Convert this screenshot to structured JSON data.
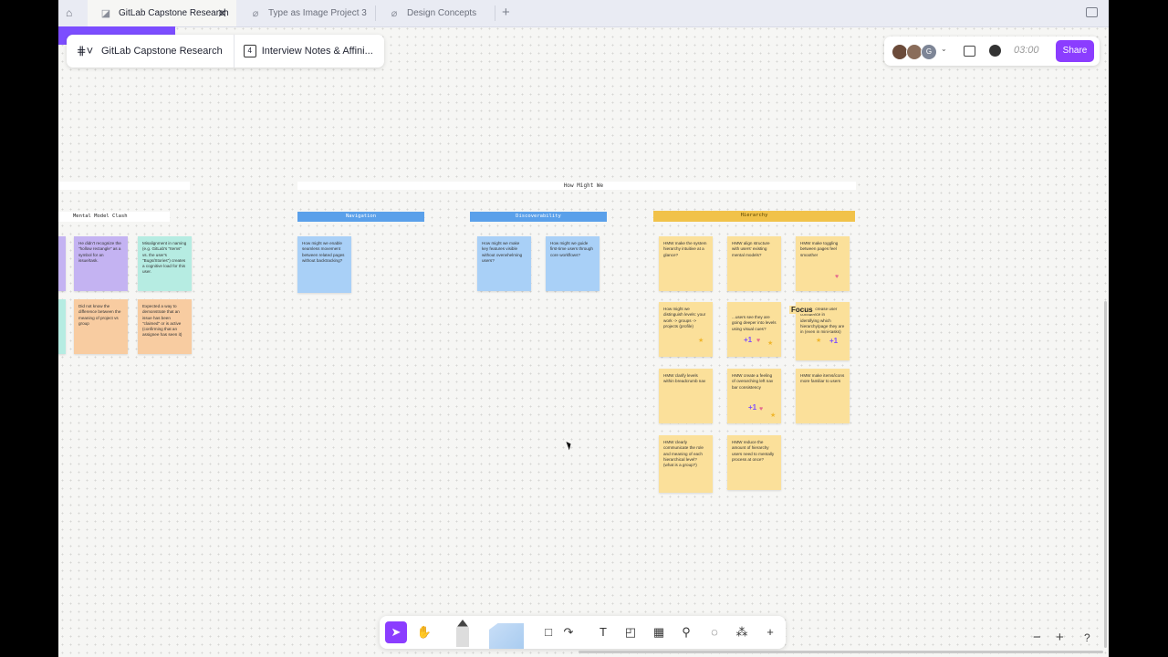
{
  "tabs": [
    {
      "label": "GitLab Capstone Research",
      "active": true
    },
    {
      "label": "Type as Image Project 3",
      "active": false
    },
    {
      "label": "Design Concepts",
      "active": false
    }
  ],
  "file": {
    "title": "GitLab Capstone Research",
    "page_number": "4",
    "page_title": "Interview Notes & Affini..."
  },
  "header_right": {
    "avatar_initial": "G",
    "timer": "03:00",
    "share_label": "Share"
  },
  "board": {
    "section_title": "How Might We",
    "columns": [
      {
        "title": "Mental Model Clash"
      },
      {
        "title": "Navigation"
      },
      {
        "title": "Discoverability"
      },
      {
        "title": "Hierarchy"
      }
    ],
    "focus_label": "Focus",
    "plus_one": "+1"
  },
  "stickies": [
    {
      "text": "He didn't recognize the \"hollow rectangle\" as a symbol for an issue/task."
    },
    {
      "text": "Misalignment in naming (e.g. GitLab's \"Items\" vs. the user's \"Bugs/Stories\") creates a cognitive load for this user."
    },
    {
      "text": "Did not know the difference between the meaning of project vs group"
    },
    {
      "text": "Expected a way to demonstrate that an issue has been \"claimed\" or is active (confirming that an assignee has seen it)"
    },
    {
      "text": "How might we enable seamless movement between related pages without backtracking?"
    },
    {
      "text": "How might we make key features visible without overwhelming users?"
    },
    {
      "text": "How might we guide first-time users through core workflows?"
    },
    {
      "text": "HMW make the system hierarchy intuitive at a glance?"
    },
    {
      "text": "HMW align structure with users' existing mental models?"
    },
    {
      "text": "HMW make toggling between pages feel smoother"
    },
    {
      "text": "How might we distinguish levels: your work -> groups -> projects (profile)"
    },
    {
      "text": "...users see they are going deeper into levels using visual cues?"
    },
    {
      "text": "HMW increase user confidence in identifying which hierarchy/page they are in (even in mini-tasks)"
    },
    {
      "text": "HMW clarify levels within breadcrumb nav"
    },
    {
      "text": "HMW create a feeling of overarching left nav bar consistency"
    },
    {
      "text": "HMW make items/icons more familiar to users"
    },
    {
      "text": "HMW clearly communicate the role and meaning of each hierarchical level? (what is a group?)"
    },
    {
      "text": "HMW reduce the amount of hierarchy users need to mentally process at once?"
    }
  ],
  "bottom_toolbar": {
    "tools": [
      "move-tool",
      "hand-tool",
      "pen-tool",
      "marker-tool",
      "shape-tool",
      "connector-tool",
      "text-tool",
      "section-tool",
      "table-tool",
      "stamp-tool",
      "sticker-tool",
      "more-tools",
      "add-tool"
    ]
  },
  "zoom_controls": {
    "minus": "−",
    "plus": "+",
    "help": "?"
  }
}
